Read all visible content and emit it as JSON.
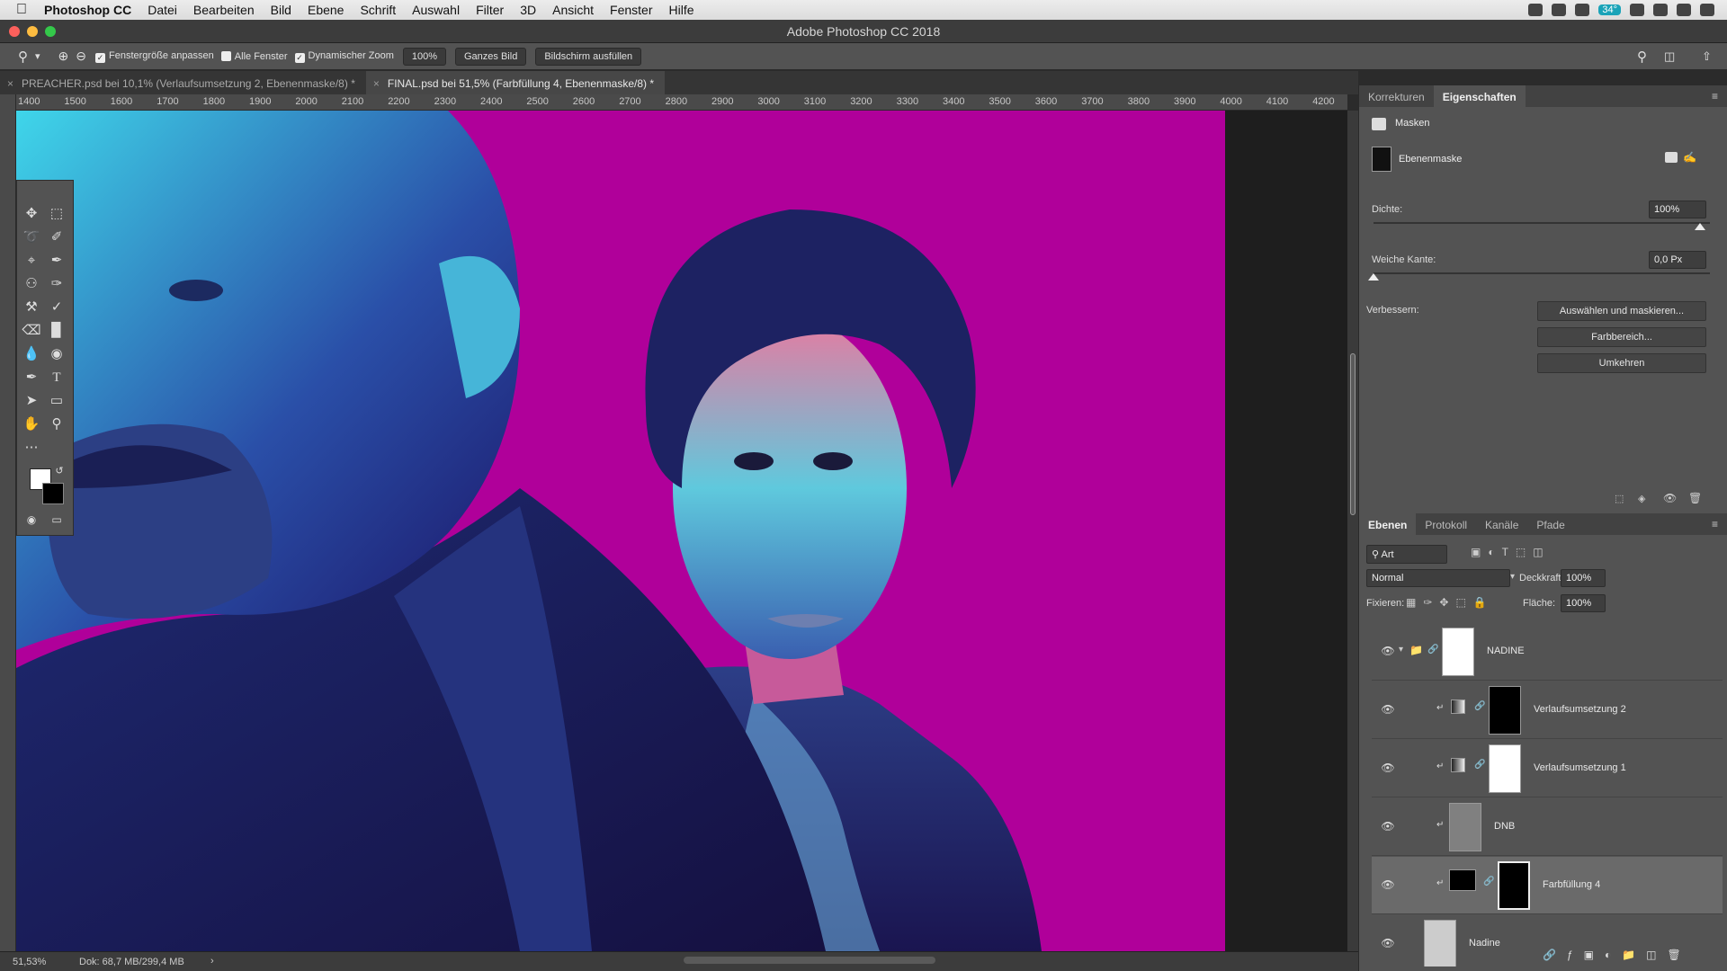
{
  "menubar": {
    "apple": "",
    "app": "Photoshop CC",
    "items": [
      "Datei",
      "Bearbeiten",
      "Bild",
      "Ebene",
      "Schrift",
      "Auswahl",
      "Filter",
      "3D",
      "Ansicht",
      "Fenster",
      "Hilfe"
    ],
    "battery_badge": "34°"
  },
  "window": {
    "title": "Adobe Photoshop CC 2018"
  },
  "options": {
    "resize_windows": "Fenstergröße anpassen",
    "all_windows": "Alle Fenster",
    "scrubby_zoom": "Dynamischer Zoom",
    "zoom_100": "100%",
    "fit_screen": "Ganzes Bild",
    "fill_screen": "Bildschirm ausfüllen"
  },
  "tabs": [
    {
      "label": "PREACHER.psd bei 10,1% (Verlaufsumsetzung 2, Ebenenmaske/8) *",
      "active": false
    },
    {
      "label": "FINAL.psd bei 51,5% (Farbfüllung 4, Ebenenmaske/8) *",
      "active": true
    }
  ],
  "ruler": {
    "top_labels": [
      "1400",
      "1500",
      "1600",
      "1700",
      "1800",
      "1900",
      "2000",
      "2100",
      "2200",
      "2300",
      "2400",
      "2500",
      "2600",
      "2700",
      "2800",
      "2900",
      "3000",
      "3100",
      "3200",
      "3300",
      "3400",
      "3500",
      "3600",
      "3700",
      "3800",
      "3900",
      "4000",
      "4100",
      "4200"
    ]
  },
  "status": {
    "zoom": "51,53%",
    "doc": "Dok: 68,7 MB/299,4 MB",
    "arrow": "›"
  },
  "properties_panel": {
    "tabs": [
      "Korrekturen",
      "Eigenschaften"
    ],
    "section": "Masken",
    "mask_type": "Ebenenmaske",
    "density_label": "Dichte:",
    "density_value": "100%",
    "feather_label": "Weiche Kante:",
    "feather_value": "0,0 Px",
    "refine_label": "Verbessern:",
    "btn_select_mask": "Auswählen und maskieren...",
    "btn_color_range": "Farbbereich...",
    "btn_invert": "Umkehren"
  },
  "layers_panel": {
    "tabs": [
      "Ebenen",
      "Protokoll",
      "Kanäle",
      "Pfade"
    ],
    "filter_kind": "Art",
    "blend_mode": "Normal",
    "opacity_label": "Deckkraft:",
    "opacity_value": "100%",
    "lock_label": "Fixieren:",
    "fill_label": "Fläche:",
    "fill_value": "100%",
    "layers": [
      {
        "name": "NADINE",
        "type": "group",
        "visible": true,
        "selected": false
      },
      {
        "name": "Verlaufsumsetzung 2",
        "type": "adjustment",
        "visible": true,
        "selected": false
      },
      {
        "name": "Verlaufsumsetzung 1",
        "type": "adjustment",
        "visible": true,
        "selected": false
      },
      {
        "name": "DNB",
        "type": "pixel",
        "visible": true,
        "selected": false
      },
      {
        "name": "Farbfüllung 4",
        "type": "fill",
        "visible": true,
        "selected": true
      },
      {
        "name": "Nadine",
        "type": "pixel",
        "visible": true,
        "selected": false
      }
    ]
  },
  "colors": {
    "accent_magenta": "#b0009a",
    "panel_bg": "#535353",
    "selected_layer": "#6a6a6a"
  }
}
